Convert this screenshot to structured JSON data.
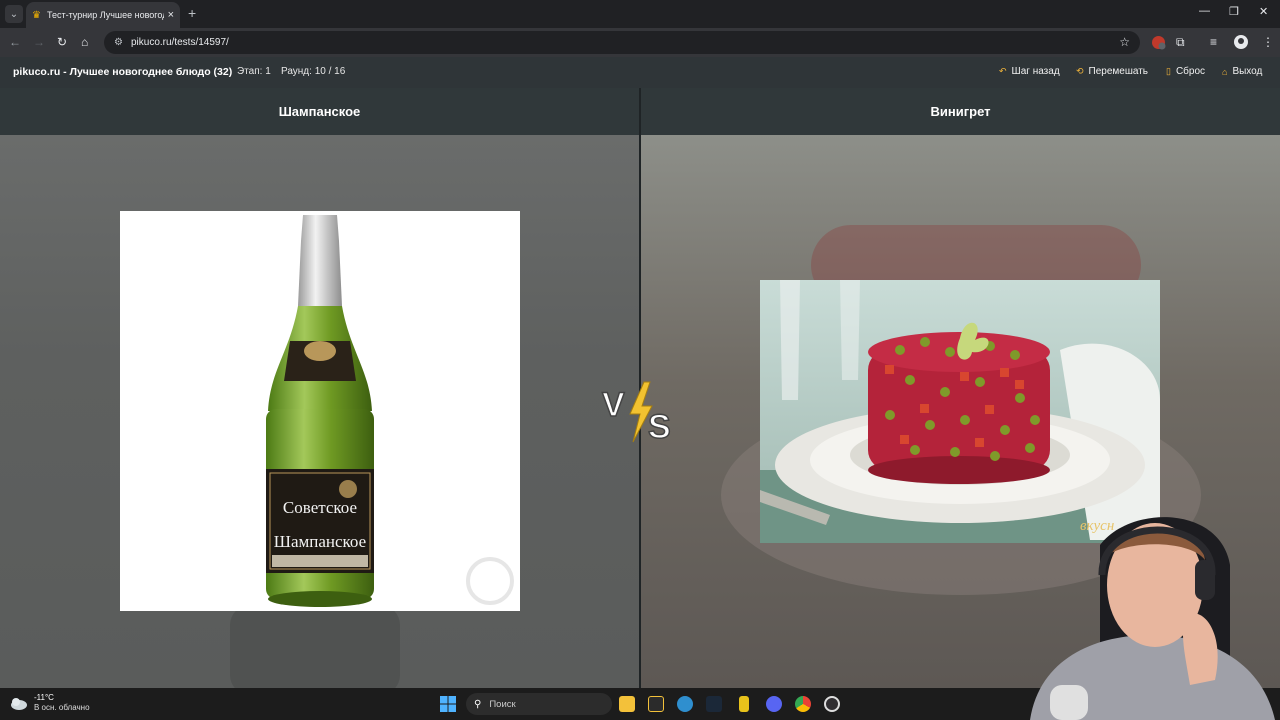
{
  "browser": {
    "tab_title": "Тест-турнир Лучшее новогодн",
    "url": "pikuco.ru/tests/14597/",
    "new_tab": "+",
    "close": "×"
  },
  "header": {
    "site_title": "pikuco.ru - Лучшее новогоднее блюдо (32)",
    "stage": "Этап: 1",
    "round": "Раунд: 10 / 16",
    "buttons": [
      {
        "label": "Шаг назад",
        "icon": "undo-icon"
      },
      {
        "label": "Перемешать",
        "icon": "shuffle-icon"
      },
      {
        "label": "Сброс",
        "icon": "reset-icon"
      },
      {
        "label": "Выход",
        "icon": "home-icon"
      }
    ]
  },
  "options": {
    "left": {
      "label": "Шампанское",
      "bottle_label_1": "Советское",
      "bottle_label_2": "Шампанское"
    },
    "right": {
      "label": "Винигрет",
      "watermark": "вкусн"
    }
  },
  "vs_badge": {
    "v": "V",
    "s": "S"
  },
  "taskbar": {
    "temperature": "-11°C",
    "condition": "В осн. облачно",
    "search_placeholder": "Поиск"
  },
  "colors": {
    "accent": "#f2b53b",
    "header_bg": "#2f3538",
    "option_bg": "#30383a"
  }
}
